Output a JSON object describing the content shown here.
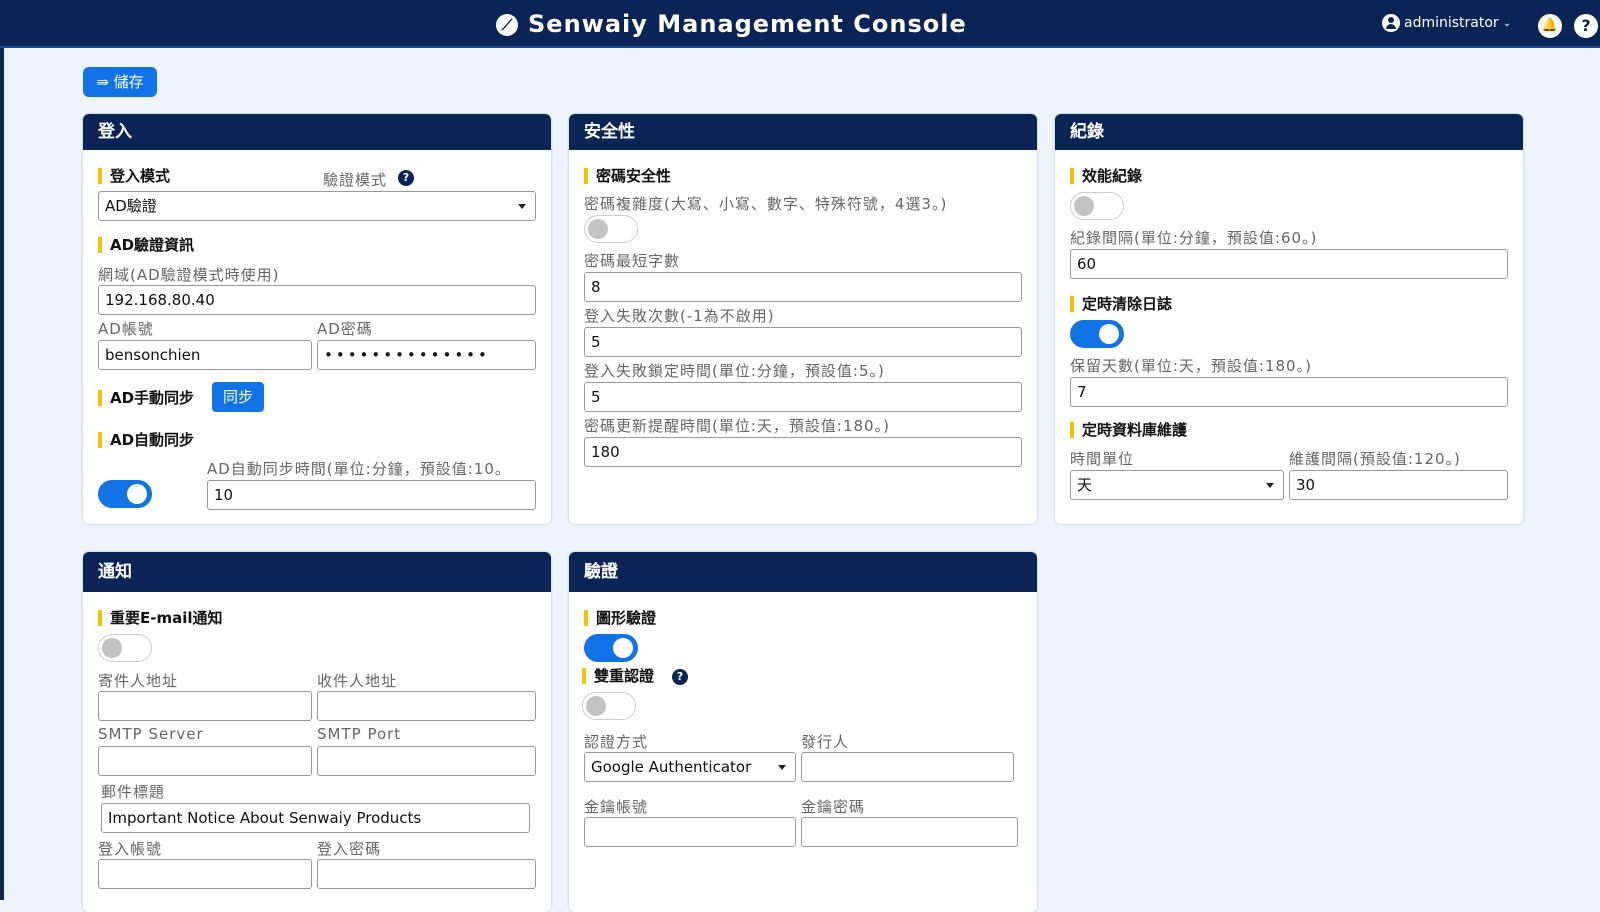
{
  "app": {
    "title": "Senwaiy Management Console",
    "logo_icon": "logo-icon",
    "user": "administrator"
  },
  "toolbar": {
    "save_label": "⇛ 儲存"
  },
  "login": {
    "header": "登入",
    "login_mode_title": "登入模式",
    "verify_mode_label": "驗證模式",
    "login_mode_value": "AD驗證",
    "ad_info_title": "AD驗證資訊",
    "domain_label": "網域(AD驗證模式時使用)",
    "domain_value": "192.168.80.40",
    "ad_account_label": "AD帳號",
    "ad_account_value": "bensonchien",
    "ad_password_label": "AD密碼",
    "ad_password_value": "••••••••••••••",
    "manual_sync_title": "AD手動同步",
    "sync_button": "同步",
    "auto_sync_title": "AD自動同步",
    "auto_sync_enabled": true,
    "auto_sync_time_label": "AD自動同步時間(單位:分鐘，預設值:10。",
    "auto_sync_time_value": "10"
  },
  "security": {
    "header": "安全性",
    "password_security_title": "密碼安全性",
    "complexity_label": "密碼複雜度(大寫、小寫、數字、特殊符號，4選3。)",
    "complexity_enabled": false,
    "min_length_label": "密碼最短字數",
    "min_length_value": "8",
    "fail_count_label": "登入失敗次數(-1為不啟用)",
    "fail_count_value": "5",
    "lock_time_label": "登入失敗鎖定時間(單位:分鐘，預設值:5。)",
    "lock_time_value": "5",
    "update_remind_label": "密碼更新提醒時間(單位:天，預設值:180。)",
    "update_remind_value": "180"
  },
  "logs": {
    "header": "紀錄",
    "perf_title": "效能紀錄",
    "perf_enabled": false,
    "interval_label": "紀錄間隔(單位:分鐘，預設值:60。)",
    "interval_value": "60",
    "purge_title": "定時清除日誌",
    "purge_enabled": true,
    "retain_label": "保留天數(單位:天，預設值:180。)",
    "retain_value": "7",
    "db_maint_title": "定時資料庫維護",
    "time_unit_label": "時間單位",
    "time_unit_value": "天",
    "maint_interval_label": "維護間隔(預設值:120。)",
    "maint_interval_value": "30"
  },
  "notify": {
    "header": "通知",
    "email_title": "重要E-mail通知",
    "email_enabled": false,
    "sender_label": "寄件人地址",
    "sender_value": "",
    "recipient_label": "收件人地址",
    "recipient_value": "",
    "smtp_server_label": "SMTP Server",
    "smtp_server_value": "",
    "smtp_port_label": "SMTP Port",
    "smtp_port_value": "",
    "subject_label": "郵件標題",
    "subject_value": "Important Notice About Senwaiy Products",
    "login_account_label": "登入帳號",
    "login_account_value": "",
    "login_password_label": "登入密碼",
    "login_password_value": ""
  },
  "verify": {
    "header": "驗證",
    "captcha_title": "圖形驗證",
    "captcha_enabled": true,
    "twofa_title": "雙重認證",
    "twofa_enabled": false,
    "method_label": "認證方式",
    "method_value": "Google Authenticator",
    "issuer_label": "發行人",
    "issuer_value": "",
    "key_account_label": "金鑰帳號",
    "key_account_value": "",
    "key_password_label": "金鑰密碼",
    "key_password_value": ""
  },
  "colors": {
    "navy": "#0b2456",
    "accent": "#1273e6",
    "section_bar": "#f5c400"
  }
}
